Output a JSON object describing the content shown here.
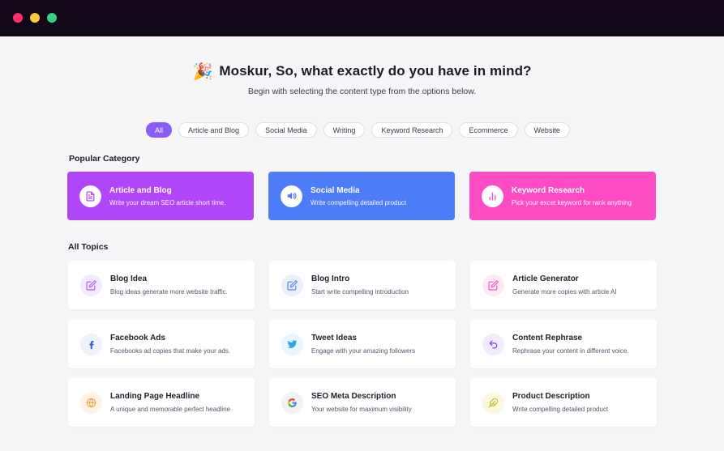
{
  "window": {
    "controls": [
      "close",
      "minimize",
      "maximize"
    ]
  },
  "header": {
    "emoji": "🎉",
    "title": "Moskur, So, what exactly do you have in mind?",
    "subtitle": "Begin with selecting the content type from the options below."
  },
  "filters": [
    {
      "label": "All",
      "active": true
    },
    {
      "label": "Article and  Blog",
      "active": false
    },
    {
      "label": "Social Media",
      "active": false
    },
    {
      "label": "Writing",
      "active": false
    },
    {
      "label": "Keyword Research",
      "active": false
    },
    {
      "label": "Ecommerce",
      "active": false
    },
    {
      "label": "Website",
      "active": false
    }
  ],
  "popular": {
    "label": "Popular Category",
    "items": [
      {
        "title": "Article and Blog",
        "desc": "Write your dream SEO article short time.",
        "icon": "document-icon",
        "color": "#b145f8"
      },
      {
        "title": "Social Media",
        "desc": "Write compelling detailed product",
        "icon": "megaphone-icon",
        "color": "#4c7cf7"
      },
      {
        "title": "Keyword Research",
        "desc": "Pick your excet keyword for rank anything",
        "icon": "bar-chart-icon",
        "color": "#fd4cc3"
      }
    ]
  },
  "topics": {
    "label": "All Topics",
    "items": [
      {
        "title": "Blog Idea",
        "desc": "Blog ideas generate more website traffic.",
        "icon": "edit-icon"
      },
      {
        "title": "Blog Intro",
        "desc": "Start write compelling introduction",
        "icon": "edit-icon"
      },
      {
        "title": "Article Generator",
        "desc": "Generate more copies with article AI",
        "icon": "edit-icon"
      },
      {
        "title": "Facebook Ads",
        "desc": "Facebooks ad copies that make your ads.",
        "icon": "facebook-icon"
      },
      {
        "title": "Tweet Ideas",
        "desc": "Engage with your amazing followers",
        "icon": "twitter-icon"
      },
      {
        "title": "Content Rephrase",
        "desc": "Rephrase your content in different voice.",
        "icon": "undo-icon"
      },
      {
        "title": "Landing Page Headline",
        "desc": "A unique and memorable perfect headline",
        "icon": "globe-icon"
      },
      {
        "title": "SEO Meta Description",
        "desc": "Your website for maximum visibility",
        "icon": "google-icon"
      },
      {
        "title": "Product Description",
        "desc": "Write compelling detailed product",
        "icon": "feather-icon"
      }
    ]
  }
}
